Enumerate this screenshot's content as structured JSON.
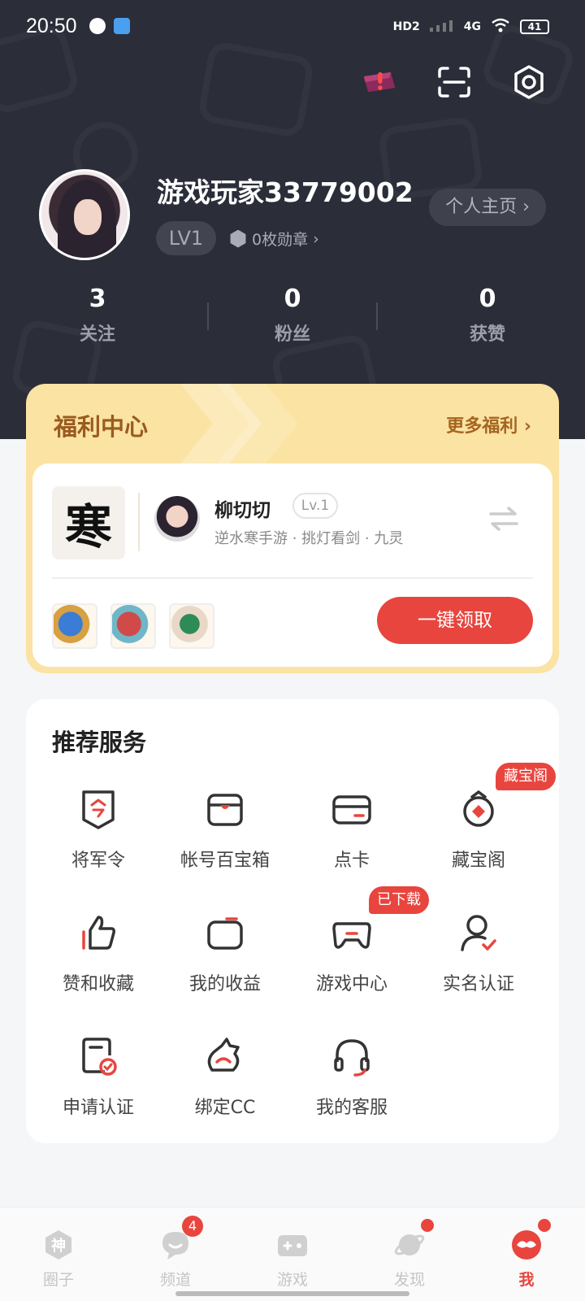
{
  "status_bar": {
    "time": "20:50",
    "network": "4G",
    "hd": "HD2",
    "battery": "41"
  },
  "profile": {
    "username": "游戏玩家33779002",
    "level": "LV1",
    "badges": "0枚勋章",
    "homepage_button": "个人主页",
    "stats": [
      {
        "value": "3",
        "label": "关注"
      },
      {
        "value": "0",
        "label": "粉丝"
      },
      {
        "value": "0",
        "label": "获赞"
      }
    ]
  },
  "welfare": {
    "title": "福利中心",
    "more": "更多福利",
    "game_logo_char": "寒",
    "role_name": "柳切切",
    "role_level": "Lv.1",
    "role_subtitle": "逆水寒手游 · 挑灯看剑 · 九灵",
    "claim_button": "一键领取"
  },
  "services": {
    "title": "推荐服务",
    "items": [
      {
        "label": "将军令",
        "icon": "shield-token-icon",
        "tag": ""
      },
      {
        "label": "帐号百宝箱",
        "icon": "treasure-box-icon",
        "tag": ""
      },
      {
        "label": "点卡",
        "icon": "card-icon",
        "tag": ""
      },
      {
        "label": "藏宝阁",
        "icon": "treasure-pavilion-icon",
        "tag": "藏宝阁"
      },
      {
        "label": "赞和收藏",
        "icon": "thumbs-up-icon",
        "tag": ""
      },
      {
        "label": "我的收益",
        "icon": "wallet-icon",
        "tag": ""
      },
      {
        "label": "游戏中心",
        "icon": "gamepad-icon",
        "tag": "已下载"
      },
      {
        "label": "实名认证",
        "icon": "user-verified-icon",
        "tag": ""
      },
      {
        "label": "申请认证",
        "icon": "certificate-icon",
        "tag": ""
      },
      {
        "label": "绑定CC",
        "icon": "cc-bind-icon",
        "tag": ""
      },
      {
        "label": "我的客服",
        "icon": "headset-icon",
        "tag": ""
      }
    ]
  },
  "bottom_nav": {
    "items": [
      {
        "label": "圈子",
        "icon": "shen-circle-icon"
      },
      {
        "label": "频道",
        "icon": "chat-bubble-icon",
        "badge": "4"
      },
      {
        "label": "游戏",
        "icon": "gamepad-icon"
      },
      {
        "label": "发现",
        "icon": "planet-icon"
      },
      {
        "label": "我",
        "icon": "me-mask-icon"
      }
    ],
    "active": "我"
  },
  "colors": {
    "header_bg": "#2b2d39",
    "accent_red": "#e8453f",
    "welfare_bg": "#fbe3a3"
  }
}
